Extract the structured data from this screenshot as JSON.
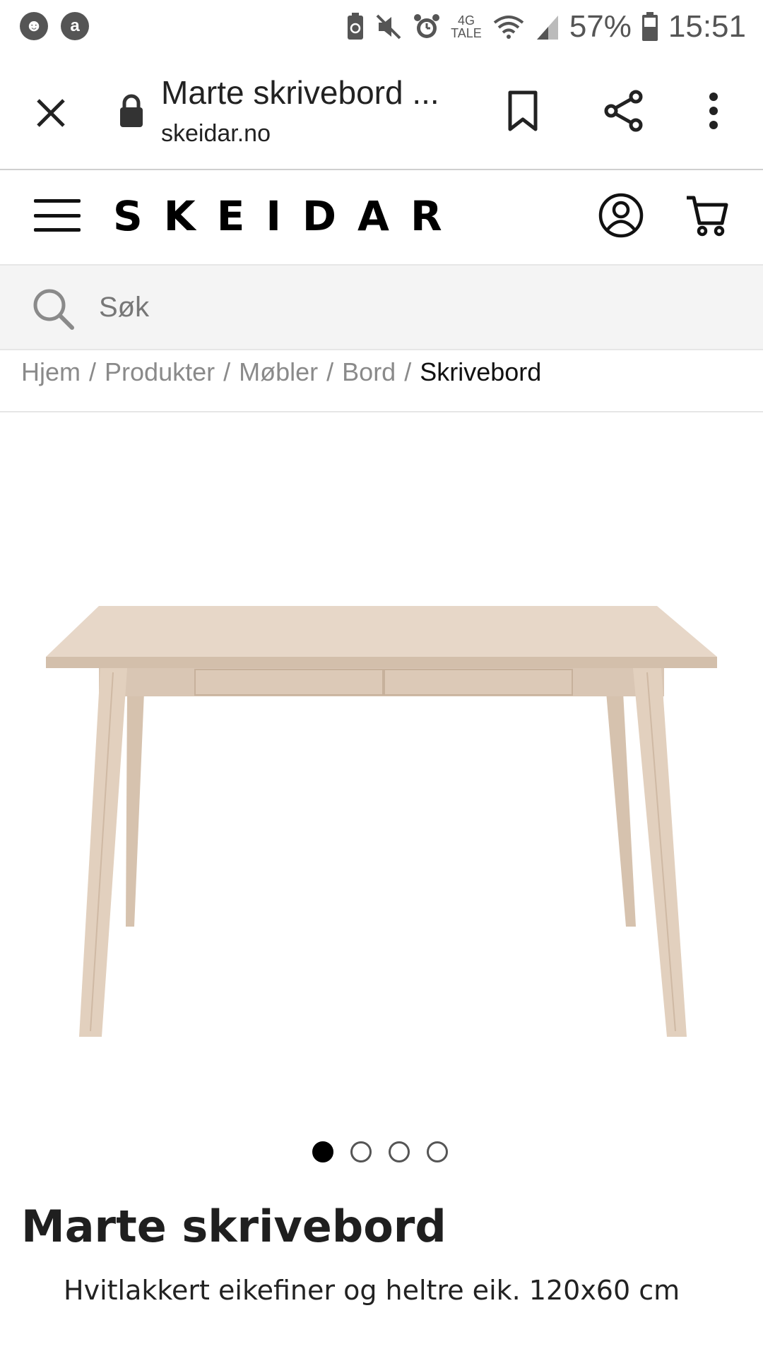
{
  "status_bar": {
    "battery": "57%",
    "time": "15:51",
    "network_label_top": "4G",
    "network_label_bottom": "TALE",
    "left_icons": [
      "notification-face-icon",
      "notification-a-icon"
    ],
    "right_icons": [
      "recycle-battery-icon",
      "mute-icon",
      "alarm-icon",
      "wifi-icon",
      "signal-icon",
      "battery-icon"
    ]
  },
  "browser": {
    "page_title": "Marte skrivebord ...",
    "url": "skeidar.no"
  },
  "site": {
    "logo": "SKEIDAR"
  },
  "search": {
    "placeholder": "Søk"
  },
  "breadcrumb": {
    "items": [
      "Hjem",
      "Produkter",
      "Møbler",
      "Bord"
    ],
    "separator": "/",
    "current": "Skrivebord"
  },
  "carousel": {
    "total": 4,
    "active_index": 0
  },
  "product": {
    "title": "Marte skrivebord",
    "description": "Hvitlakkert eikefiner og heltre eik. 120x60 cm"
  },
  "colors": {
    "wood_light": "#e7d7c8",
    "wood_mid": "#d9c6b4",
    "wood_shadow": "#c8b39f",
    "search_bg": "#f4f4f4"
  }
}
